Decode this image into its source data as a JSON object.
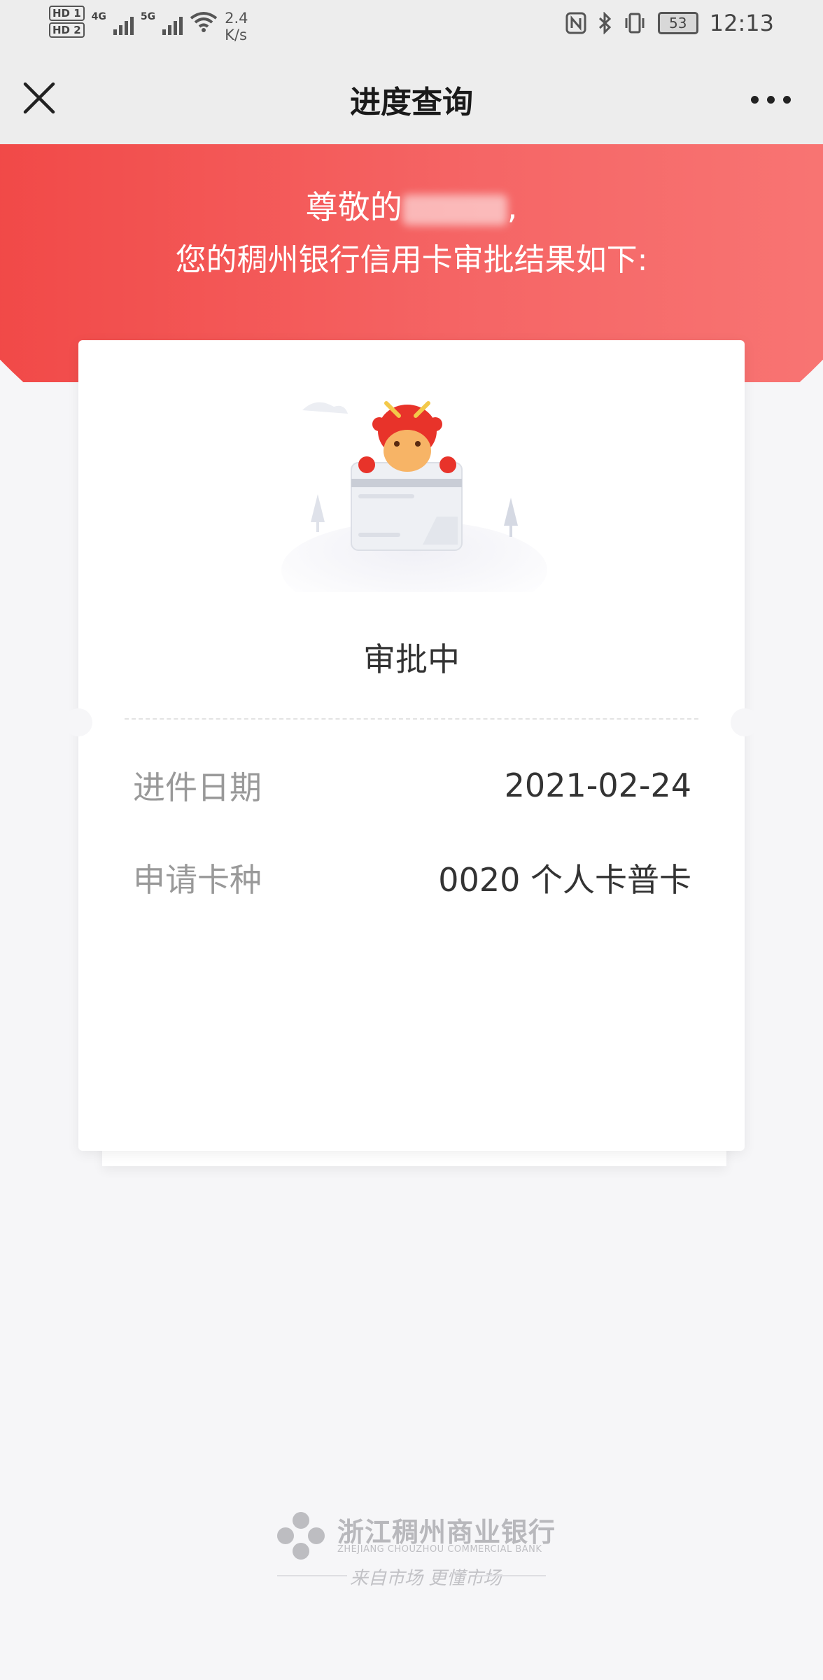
{
  "status_bar": {
    "hd1": "HD 1",
    "hd2": "HD 2",
    "net1": "4G",
    "net2": "5G",
    "speed_value": "2.4",
    "speed_unit": "K/s",
    "battery": "53",
    "time": "12:13"
  },
  "header": {
    "title": "进度查询"
  },
  "hero": {
    "greeting_prefix": "尊敬的",
    "greeting_suffix": ",",
    "subtitle": "您的稠州银行信用卡审批结果如下:"
  },
  "card": {
    "status": "审批中",
    "rows": [
      {
        "label": "进件日期",
        "value": "2021-02-24"
      },
      {
        "label": "申请卡种",
        "value": "0020 个人卡普卡"
      }
    ]
  },
  "footer": {
    "bank_name_cn": "浙江稠州商业银行",
    "bank_name_en": "ZHEJIANG CHOUZHOU COMMERCIAL BANK",
    "slogan": "来自市场 更懂市场"
  },
  "colors": {
    "accent_red": "#f0413f",
    "background": "#f6f6f8"
  }
}
